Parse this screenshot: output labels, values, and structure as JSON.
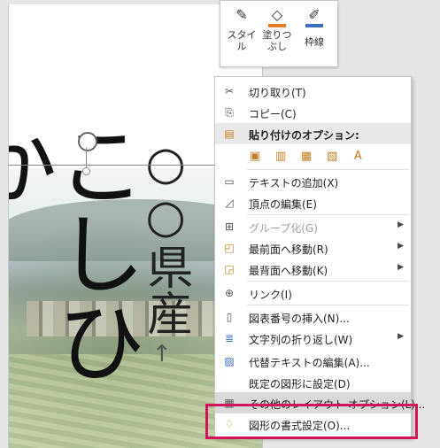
{
  "mini_toolbar": {
    "style_label_1": "スタイ",
    "style_label_2": "ル",
    "fill_label_1": "塗りつ",
    "fill_label_2": "ぶし",
    "outline_label": "枠線",
    "style_icon": "shape-style-icon",
    "fill_icon": "paint-bucket-icon",
    "outline_icon": "pen-outline-icon",
    "fill_color": "#e87d2a",
    "outline_color": "#3a6fc4"
  },
  "document": {
    "big_text": "こしひか",
    "vertical_text": "○○県産",
    "arrow_text": "↑"
  },
  "context_menu": {
    "items": [
      {
        "label": "切り取り(T)",
        "icon": "scissors-icon"
      },
      {
        "label": "コピー(C)",
        "icon": "copy-icon"
      },
      {
        "label": "貼り付けのオプション:",
        "icon": "clipboard-icon"
      },
      {
        "label": "テキストの追加(X)",
        "icon": "text-box-icon"
      },
      {
        "label": "頂点の編集(E)",
        "icon": "edit-points-icon"
      },
      {
        "label": "グループ化(G)",
        "icon": "group-icon"
      },
      {
        "label": "最前面へ移動(R)",
        "icon": "bring-front-icon"
      },
      {
        "label": "最背面へ移動(K)",
        "icon": "send-back-icon"
      },
      {
        "label": "リンク(I)",
        "icon": "link-icon"
      },
      {
        "label": "図表番号の挿入(N)...",
        "icon": "caption-icon"
      },
      {
        "label": "文字列の折り返し(W)",
        "icon": "wrap-text-icon"
      },
      {
        "label": "代替テキストの編集(A)...",
        "icon": "alt-text-icon"
      },
      {
        "label": "既定の図形に設定(D)",
        "icon": ""
      },
      {
        "label": "その他のレイアウト オプション(L)...",
        "icon": "layout-icon"
      },
      {
        "label": "図形の書式設定(O)...",
        "icon": "format-shape-icon"
      }
    ],
    "paste_icons": [
      "paste-keep-format-icon",
      "paste-merge-icon",
      "paste-picture-icon",
      "paste-link-icon",
      "paste-text-only-icon"
    ]
  },
  "colors": {
    "highlight": "#d4145a"
  }
}
